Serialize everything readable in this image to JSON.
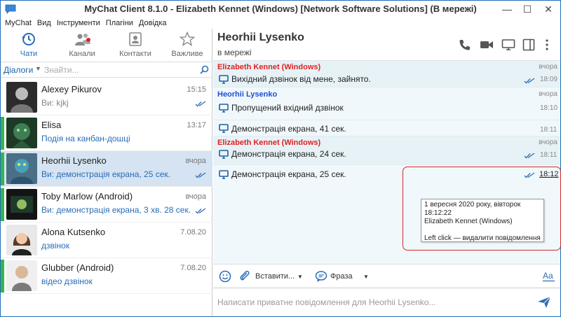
{
  "window": {
    "title": "MyChat Client 8.1.0 - Elizabeth Kennet (Windows) [Network Software Solutions] (В мережі)",
    "min_glyph": "—",
    "max_glyph": "☐",
    "close_glyph": "✕"
  },
  "menu": [
    "MyChat",
    "Вид",
    "Інструменти",
    "Плагіни",
    "Довідка"
  ],
  "nav": [
    {
      "label": "Чати",
      "icon": "history-icon",
      "active": true
    },
    {
      "label": "Канали",
      "icon": "channels-icon",
      "active": false
    },
    {
      "label": "Контакти",
      "icon": "contacts-icon",
      "active": false
    },
    {
      "label": "Важливе",
      "icon": "star-icon",
      "active": false
    }
  ],
  "search": {
    "selector_label": "Діалоги",
    "placeholder": "Знайти..."
  },
  "dialogs": [
    {
      "name": "Alexey Pikurov",
      "subtitle": "Ви: kjkj",
      "time": "15:15",
      "checks": true,
      "online": false,
      "selected": false,
      "avatar_icon": "avatar-alexey"
    },
    {
      "name": "Elisa",
      "subtitle": "Подія на канбан-дошці",
      "time": "13:17",
      "checks": false,
      "online": true,
      "selected": false,
      "avatar_icon": "avatar-elisa"
    },
    {
      "name": "Heorhii Lysenko",
      "subtitle": "Ви: демонстрація екрана, 25 сек.",
      "time": "вчора",
      "checks": true,
      "online": true,
      "selected": true,
      "avatar_icon": "avatar-heorhii"
    },
    {
      "name": "Toby Marlow (Android)",
      "subtitle": "Ви: демонстрація екрана, 3 хв. 28 сек.",
      "time": "вчора",
      "checks": true,
      "online": true,
      "selected": false,
      "avatar_icon": "avatar-toby"
    },
    {
      "name": "Alona Kutsenko",
      "subtitle": "дзвінок",
      "time": "7.08.20",
      "checks": false,
      "online": false,
      "selected": false,
      "avatar_icon": "avatar-alona"
    },
    {
      "name": "Glubber (Android)",
      "subtitle": "відео дзвінок",
      "time": "7.08.20",
      "checks": false,
      "online": true,
      "selected": false,
      "avatar_icon": "avatar-glubber"
    }
  ],
  "chat": {
    "peer_name": "Heorhii Lysenko",
    "peer_status": "в мережі",
    "messages": [
      {
        "author": "Elizabeth Kennet (Windows)",
        "author_color": "#e02020",
        "date": "вчора",
        "text": "Вихідний дзвінок від мене, зайнято.",
        "time": "18:09",
        "checks": true
      },
      {
        "author": "Heorhii Lysenko",
        "author_color": "#1e4fd2",
        "date": "вчора",
        "text": "Пропущений вхідний дзвінок",
        "time": "18:10",
        "checks": false
      },
      {
        "author": "",
        "date": "",
        "text": "Демонстрація екрана, 41 сек.",
        "time": "18:11",
        "checks": false
      },
      {
        "author": "Elizabeth Kennet (Windows)",
        "author_color": "#e02020",
        "date": "вчора",
        "text": "Демонстрація екрана, 24 сек.",
        "time": "18:11",
        "checks": true
      },
      {
        "author": "",
        "date": "",
        "text": "Демонстрація екрана, 25 сек.",
        "time": "18:12",
        "checks": true
      }
    ],
    "tooltip": {
      "line1": "1 вересня 2020 року, вівторок",
      "line2": "18:12:22",
      "line3": "Elizabeth Kennet (Windows)",
      "line4": "Left click — видалити повідомлення"
    },
    "highlight_color": "#d02929"
  },
  "toolbar": {
    "insert_label": "Вставити...",
    "phrase_label": "Фраза"
  },
  "compose": {
    "placeholder": "Написати приватне повідомлення для Heorhii Lysenko..."
  },
  "colors": {
    "accent": "#2a6db7",
    "online": "#35b64a",
    "selected_bg": "#d5e3f2",
    "chat_bg": "#f1f8fb"
  }
}
